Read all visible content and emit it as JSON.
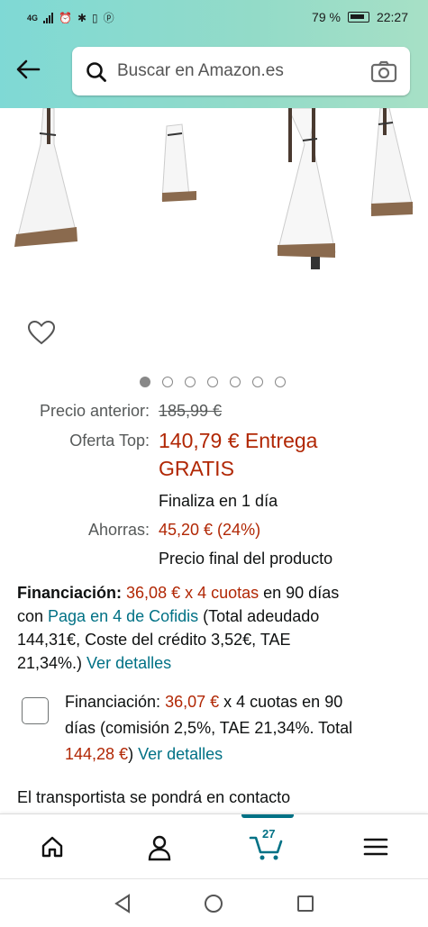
{
  "status_bar": {
    "network": "4G",
    "battery": "79 %",
    "time": "22:27"
  },
  "header": {
    "search_placeholder": "Buscar en Amazon.es"
  },
  "carousel": {
    "count": 7,
    "active": 1
  },
  "price": {
    "previous_label": "Precio anterior:",
    "previous_value": "185,99 €",
    "offer_label": "Oferta Top:",
    "offer_value": "140,79 €",
    "offer_extra": " Entrega",
    "offer_extra2": "GRATIS",
    "offer_ends": "Finaliza en 1 día",
    "savings_label": "Ahorras:",
    "savings_value": "45,20 € (24%)",
    "final_note": "Precio final del producto"
  },
  "financing1": {
    "label": "Financiación:",
    "amount": "36,08 € x 4 cuotas",
    "text1": " en 90 días",
    "text2": "con ",
    "provider": "Paga en 4 de Cofidis",
    "text3": " (Total adeudado",
    "text4": "144,31€, Coste del crédito 3,52€, TAE",
    "text5": "21,34%.) ",
    "details": "Ver detalles"
  },
  "financing2": {
    "label": "Financiación: ",
    "amount": "36,07 €",
    "text1": " x 4 cuotas en 90",
    "text2": "días (comisión 2,5%, TAE 21,34%. Total",
    "total": "144,28 €",
    "text3": ") ",
    "details": "Ver detalles"
  },
  "delivery_note": "El transportista se pondrá en contacto",
  "bottom_nav": {
    "cart_count": "27"
  }
}
